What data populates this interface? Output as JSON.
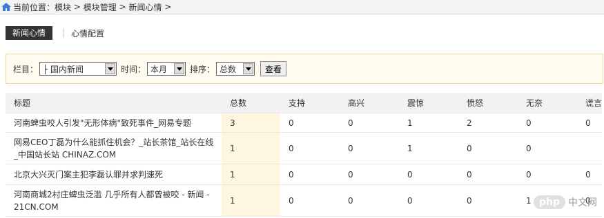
{
  "breadcrumb": {
    "label": "当前位置：",
    "items": [
      "模块",
      ">",
      "模块管理",
      ">",
      "新闻心情",
      ">"
    ]
  },
  "tabs": [
    {
      "label": "新闻心情",
      "active": true
    },
    {
      "label": "心情配置",
      "active": false
    }
  ],
  "filter": {
    "column_label": "栏目：",
    "column_value": "├ 国内新闻",
    "time_label": "时间：",
    "time_value": "本月",
    "sort_label": "排序：",
    "sort_value": "总数",
    "view_button": "查看"
  },
  "table": {
    "headers": [
      "标题",
      "总数",
      "支持",
      "高兴",
      "震惊",
      "愤怒",
      "无奈",
      "谎言"
    ],
    "rows": [
      {
        "title": "河南蜱虫咬人引发\"无形体病\"致死事件_网易专题",
        "values": [
          "3",
          "0",
          "0",
          "1",
          "2",
          "0",
          "0"
        ]
      },
      {
        "title": "网易CEO丁磊为什么能抓住机会？_站长茶馆_站长在线_中国站长站 CHINAZ.COM",
        "values": [
          "1",
          "0",
          "0",
          "1",
          "0",
          "0"
        ]
      },
      {
        "title": "北京大兴灭门案主犯李磊认罪并求判速死",
        "values": [
          "1",
          "0",
          "0",
          "0",
          "0",
          "0",
          "0"
        ]
      },
      {
        "title": "河南商城2村庄蜱虫泛滥 几乎所有人都曾被咬 - 新闻 - 21CN.COM",
        "values": [
          "1",
          "0",
          "0",
          "0",
          "0",
          "1",
          "0"
        ]
      }
    ]
  },
  "watermark": {
    "badge": "php",
    "text": "中文网"
  },
  "colors": {
    "accent_tab": "#333333",
    "filter_bg": "#fffbee",
    "highlight_col": "#fff6e0"
  }
}
